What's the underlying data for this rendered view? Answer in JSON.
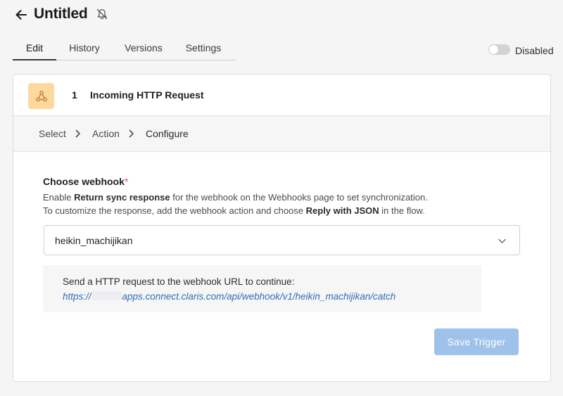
{
  "header": {
    "title": "Untitled",
    "back_icon": "arrow-left-icon",
    "notification_icon": "bell-off-icon"
  },
  "tabs": [
    {
      "label": "Edit",
      "active": true
    },
    {
      "label": "History",
      "active": false
    },
    {
      "label": "Versions",
      "active": false
    },
    {
      "label": "Settings",
      "active": false
    }
  ],
  "status_toggle": {
    "label": "Disabled",
    "enabled": false
  },
  "step": {
    "number": "1",
    "title": "Incoming HTTP Request",
    "icon": "webhook-icon",
    "icon_bg": "#fdd99f"
  },
  "breadcrumbs": [
    "Select",
    "Action",
    "Configure"
  ],
  "form": {
    "label": "Choose webhook",
    "required_mark": "*",
    "help_line1_pre": "Enable ",
    "help_line1_bold": "Return sync response",
    "help_line1_post": " for the webhook on the Webhooks page to set synchronization.",
    "help_line2_pre": "To customize the response, add the webhook action and choose ",
    "help_line2_bold": "Reply with JSON",
    "help_line2_post": " in the flow.",
    "selected_webhook": "heikin_machijikan"
  },
  "info": {
    "text": "Send a HTTP request to the webhook URL to continue:",
    "url_prefix": "https://",
    "url_suffix": "apps.connect.claris.com/api/webhook/v1/heikin_machijikan/catch"
  },
  "save_button": {
    "label": "Save Trigger"
  },
  "colors": {
    "accent": "#2f6fb2",
    "button_disabled": "#9ec2ea",
    "required": "#e05a5a"
  }
}
